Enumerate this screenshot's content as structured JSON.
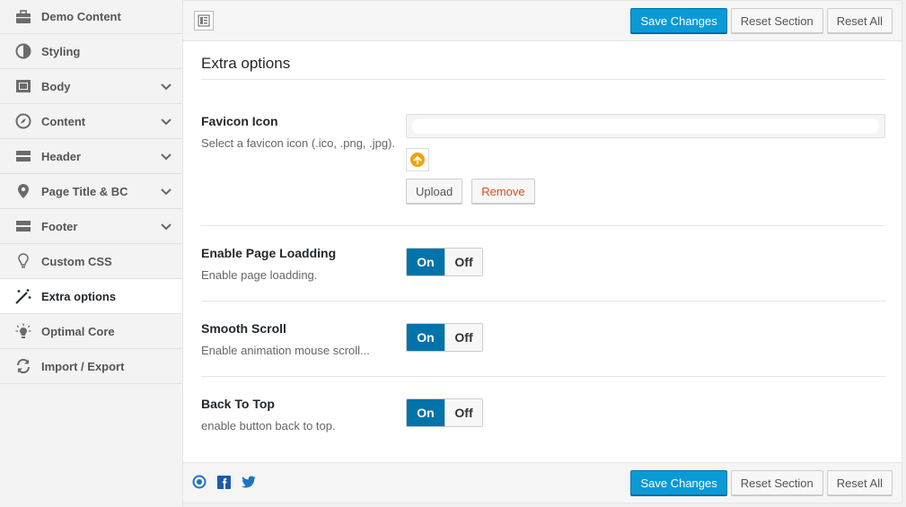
{
  "sidebar": {
    "items": [
      {
        "label": "Demo Content",
        "icon": "briefcase-icon",
        "chevron": false,
        "active": false
      },
      {
        "label": "Styling",
        "icon": "half-circle-icon",
        "chevron": false,
        "active": false
      },
      {
        "label": "Body",
        "icon": "layout-icon",
        "chevron": true,
        "active": false
      },
      {
        "label": "Content",
        "icon": "compass-icon",
        "chevron": true,
        "active": false
      },
      {
        "label": "Header",
        "icon": "header-icon",
        "chevron": true,
        "active": false
      },
      {
        "label": "Page Title & BC",
        "icon": "map-pin-icon",
        "chevron": true,
        "active": false
      },
      {
        "label": "Footer",
        "icon": "footer-icon",
        "chevron": true,
        "active": false
      },
      {
        "label": "Custom CSS",
        "icon": "lightbulb-icon",
        "chevron": false,
        "active": false
      },
      {
        "label": "Extra options",
        "icon": "magic-wand-icon",
        "chevron": false,
        "active": true
      },
      {
        "label": "Optimal Core",
        "icon": "lightbulb-rays-icon",
        "chevron": false,
        "active": false
      },
      {
        "label": "Import / Export",
        "icon": "refresh-icon",
        "chevron": false,
        "active": false
      }
    ]
  },
  "toolbar": {
    "save_label": "Save Changes",
    "reset_section_label": "Reset Section",
    "reset_all_label": "Reset All"
  },
  "section": {
    "title": "Extra options",
    "favicon": {
      "label": "Favicon Icon",
      "desc": "Select a favicon icon (.ico, .png, .jpg).",
      "upload_label": "Upload",
      "remove_label": "Remove"
    },
    "toggles": [
      {
        "label": "Enable Page Loadding",
        "desc": "Enable page loadding.",
        "on": "On",
        "off": "Off",
        "state": "on"
      },
      {
        "label": "Smooth Scroll",
        "desc": "Enable animation mouse scroll...",
        "on": "On",
        "off": "Off",
        "state": "on"
      },
      {
        "label": "Back To Top",
        "desc": "enable button back to top.",
        "on": "On",
        "off": "Off",
        "state": "on"
      }
    ]
  },
  "colors": {
    "primary": "#0a9ad6",
    "toggle_on": "#0073aa",
    "remove": "#d54e21"
  }
}
